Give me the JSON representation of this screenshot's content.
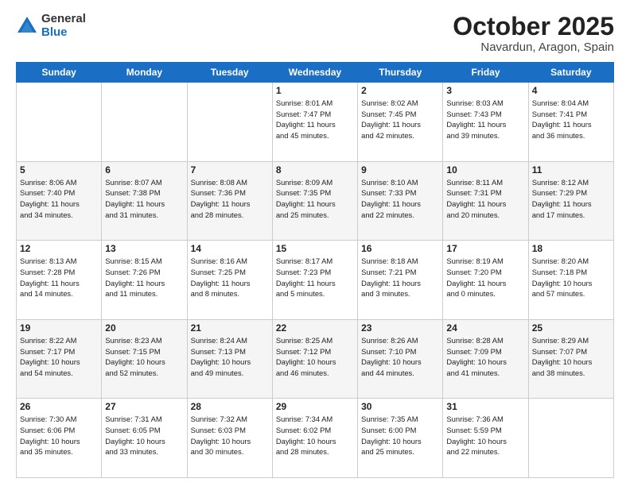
{
  "logo": {
    "general": "General",
    "blue": "Blue"
  },
  "title": {
    "month": "October 2025",
    "location": "Navardun, Aragon, Spain"
  },
  "days_of_week": [
    "Sunday",
    "Monday",
    "Tuesday",
    "Wednesday",
    "Thursday",
    "Friday",
    "Saturday"
  ],
  "weeks": [
    [
      {
        "day": "",
        "info": ""
      },
      {
        "day": "",
        "info": ""
      },
      {
        "day": "",
        "info": ""
      },
      {
        "day": "1",
        "info": "Sunrise: 8:01 AM\nSunset: 7:47 PM\nDaylight: 11 hours\nand 45 minutes."
      },
      {
        "day": "2",
        "info": "Sunrise: 8:02 AM\nSunset: 7:45 PM\nDaylight: 11 hours\nand 42 minutes."
      },
      {
        "day": "3",
        "info": "Sunrise: 8:03 AM\nSunset: 7:43 PM\nDaylight: 11 hours\nand 39 minutes."
      },
      {
        "day": "4",
        "info": "Sunrise: 8:04 AM\nSunset: 7:41 PM\nDaylight: 11 hours\nand 36 minutes."
      }
    ],
    [
      {
        "day": "5",
        "info": "Sunrise: 8:06 AM\nSunset: 7:40 PM\nDaylight: 11 hours\nand 34 minutes."
      },
      {
        "day": "6",
        "info": "Sunrise: 8:07 AM\nSunset: 7:38 PM\nDaylight: 11 hours\nand 31 minutes."
      },
      {
        "day": "7",
        "info": "Sunrise: 8:08 AM\nSunset: 7:36 PM\nDaylight: 11 hours\nand 28 minutes."
      },
      {
        "day": "8",
        "info": "Sunrise: 8:09 AM\nSunset: 7:35 PM\nDaylight: 11 hours\nand 25 minutes."
      },
      {
        "day": "9",
        "info": "Sunrise: 8:10 AM\nSunset: 7:33 PM\nDaylight: 11 hours\nand 22 minutes."
      },
      {
        "day": "10",
        "info": "Sunrise: 8:11 AM\nSunset: 7:31 PM\nDaylight: 11 hours\nand 20 minutes."
      },
      {
        "day": "11",
        "info": "Sunrise: 8:12 AM\nSunset: 7:29 PM\nDaylight: 11 hours\nand 17 minutes."
      }
    ],
    [
      {
        "day": "12",
        "info": "Sunrise: 8:13 AM\nSunset: 7:28 PM\nDaylight: 11 hours\nand 14 minutes."
      },
      {
        "day": "13",
        "info": "Sunrise: 8:15 AM\nSunset: 7:26 PM\nDaylight: 11 hours\nand 11 minutes."
      },
      {
        "day": "14",
        "info": "Sunrise: 8:16 AM\nSunset: 7:25 PM\nDaylight: 11 hours\nand 8 minutes."
      },
      {
        "day": "15",
        "info": "Sunrise: 8:17 AM\nSunset: 7:23 PM\nDaylight: 11 hours\nand 5 minutes."
      },
      {
        "day": "16",
        "info": "Sunrise: 8:18 AM\nSunset: 7:21 PM\nDaylight: 11 hours\nand 3 minutes."
      },
      {
        "day": "17",
        "info": "Sunrise: 8:19 AM\nSunset: 7:20 PM\nDaylight: 11 hours\nand 0 minutes."
      },
      {
        "day": "18",
        "info": "Sunrise: 8:20 AM\nSunset: 7:18 PM\nDaylight: 10 hours\nand 57 minutes."
      }
    ],
    [
      {
        "day": "19",
        "info": "Sunrise: 8:22 AM\nSunset: 7:17 PM\nDaylight: 10 hours\nand 54 minutes."
      },
      {
        "day": "20",
        "info": "Sunrise: 8:23 AM\nSunset: 7:15 PM\nDaylight: 10 hours\nand 52 minutes."
      },
      {
        "day": "21",
        "info": "Sunrise: 8:24 AM\nSunset: 7:13 PM\nDaylight: 10 hours\nand 49 minutes."
      },
      {
        "day": "22",
        "info": "Sunrise: 8:25 AM\nSunset: 7:12 PM\nDaylight: 10 hours\nand 46 minutes."
      },
      {
        "day": "23",
        "info": "Sunrise: 8:26 AM\nSunset: 7:10 PM\nDaylight: 10 hours\nand 44 minutes."
      },
      {
        "day": "24",
        "info": "Sunrise: 8:28 AM\nSunset: 7:09 PM\nDaylight: 10 hours\nand 41 minutes."
      },
      {
        "day": "25",
        "info": "Sunrise: 8:29 AM\nSunset: 7:07 PM\nDaylight: 10 hours\nand 38 minutes."
      }
    ],
    [
      {
        "day": "26",
        "info": "Sunrise: 7:30 AM\nSunset: 6:06 PM\nDaylight: 10 hours\nand 35 minutes."
      },
      {
        "day": "27",
        "info": "Sunrise: 7:31 AM\nSunset: 6:05 PM\nDaylight: 10 hours\nand 33 minutes."
      },
      {
        "day": "28",
        "info": "Sunrise: 7:32 AM\nSunset: 6:03 PM\nDaylight: 10 hours\nand 30 minutes."
      },
      {
        "day": "29",
        "info": "Sunrise: 7:34 AM\nSunset: 6:02 PM\nDaylight: 10 hours\nand 28 minutes."
      },
      {
        "day": "30",
        "info": "Sunrise: 7:35 AM\nSunset: 6:00 PM\nDaylight: 10 hours\nand 25 minutes."
      },
      {
        "day": "31",
        "info": "Sunrise: 7:36 AM\nSunset: 5:59 PM\nDaylight: 10 hours\nand 22 minutes."
      },
      {
        "day": "",
        "info": ""
      }
    ]
  ]
}
